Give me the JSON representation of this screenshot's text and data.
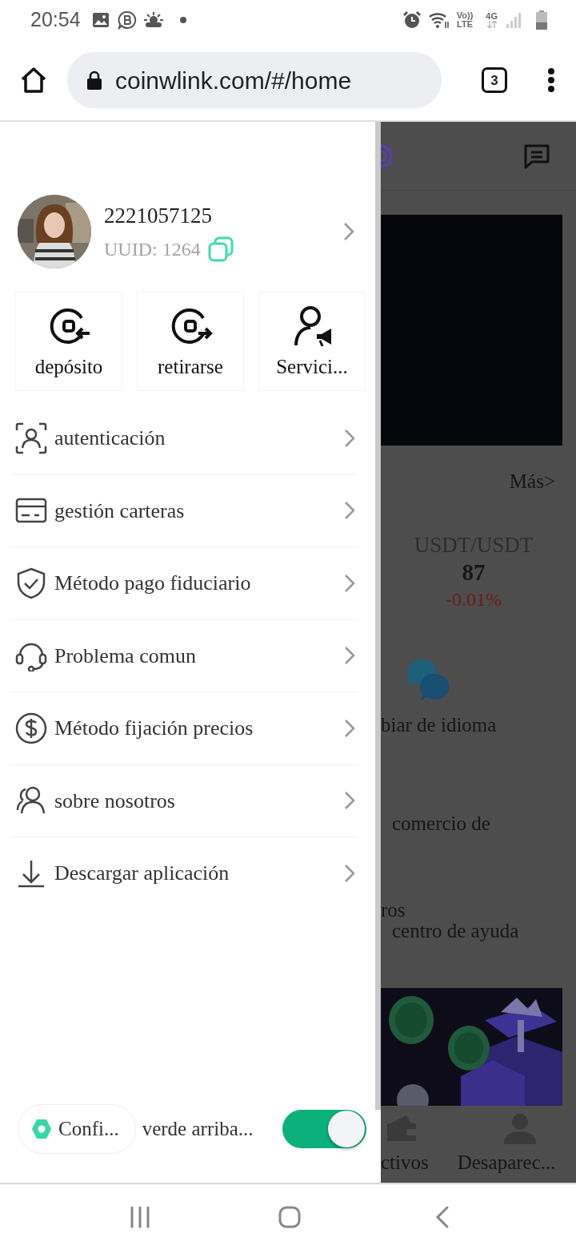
{
  "status_bar": {
    "time": "20:54",
    "volte": "Vo))",
    "lte": "LTE",
    "network": "4G"
  },
  "browser": {
    "url": "coinwlink.com/#/home",
    "tab_count": "3"
  },
  "drawer": {
    "profile": {
      "name": "2221057125",
      "uuid": "UUID: 1264"
    },
    "actions": [
      {
        "label": "depósito",
        "kind": "deposit"
      },
      {
        "label": "retirarse",
        "kind": "withdraw"
      },
      {
        "label": "Servici...",
        "kind": "service"
      }
    ],
    "menu": [
      {
        "label": "autenticación",
        "kind": "id"
      },
      {
        "label": "gestión carteras",
        "kind": "card"
      },
      {
        "label": "Método pago fiduciario",
        "kind": "shield"
      },
      {
        "label": "Problema comun",
        "kind": "headset"
      },
      {
        "label": "Método fijación precios",
        "kind": "dollar"
      },
      {
        "label": "sobre nosotros",
        "kind": "people"
      },
      {
        "label": "Descargar aplicación",
        "kind": "download"
      }
    ],
    "footer": {
      "chip": "Confi...",
      "toggle_label": "verde arriba...",
      "on": true
    }
  },
  "page": {
    "more_link": "Más>",
    "ticker": {
      "pair": "USDT/USDT",
      "price": "87",
      "change": "-0.01%"
    },
    "language": "biar de idioma",
    "trade": "comercio de",
    "partial": "ros",
    "help": "centro de ayuda",
    "tabs": [
      {
        "label": "ctivos",
        "kind": "wallet"
      },
      {
        "label": "Desaparec...",
        "kind": "person"
      }
    ]
  }
}
